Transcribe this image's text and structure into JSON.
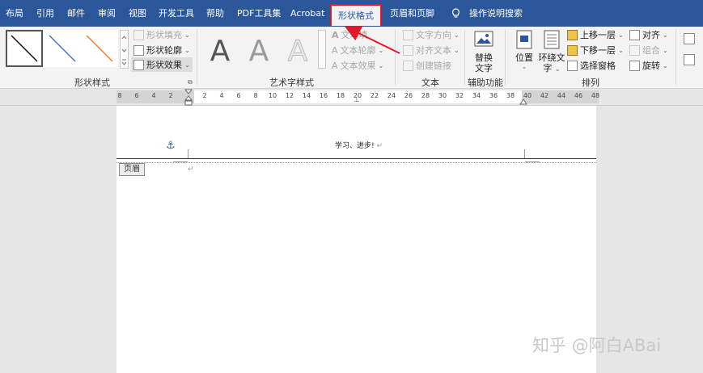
{
  "tabs": [
    {
      "label": "布局"
    },
    {
      "label": "引用"
    },
    {
      "label": "邮件"
    },
    {
      "label": "审阅"
    },
    {
      "label": "视图"
    },
    {
      "label": "开发工具"
    },
    {
      "label": "帮助"
    },
    {
      "label": "PDF工具集"
    },
    {
      "label": "Acrobat"
    },
    {
      "label": "形状格式"
    },
    {
      "label": "页眉和页脚"
    }
  ],
  "search": {
    "label": "操作说明搜索"
  },
  "ribbon": {
    "shape_styles": {
      "label": "形状样式",
      "fill": "形状填充",
      "outline": "形状轮廓",
      "effects": "形状效果"
    },
    "wordart": {
      "label": "艺术字样式",
      "glyph": "A",
      "text_fill": "文本填",
      "text_outline": "文本轮廓",
      "text_effects": "文本效果"
    },
    "text": {
      "label": "文本",
      "direction": "文字方向",
      "align": "对齐文本",
      "link": "创建链接"
    },
    "accessibility": {
      "label": "辅助功能",
      "alt_text_1": "替换",
      "alt_text_2": "文字"
    },
    "arrange": {
      "label": "排列",
      "position": "位置",
      "wrap_1": "环绕文",
      "wrap_2": "字",
      "bring_forward": "上移一层",
      "send_backward": "下移一层",
      "selection_pane": "选择窗格",
      "align": "对齐",
      "group": "组合",
      "rotate": "旋转"
    }
  },
  "ruler": {
    "left_ticks": [
      "8",
      "6",
      "4",
      "2"
    ],
    "ticks": [
      "2",
      "4",
      "6",
      "8",
      "10",
      "12",
      "14",
      "16",
      "18",
      "20",
      "22",
      "24",
      "26",
      "28",
      "30",
      "32",
      "34",
      "36",
      "38"
    ],
    "right_ticks": [
      "40",
      "42",
      "44",
      "46",
      "48"
    ]
  },
  "document": {
    "header_text": "学习、进步!",
    "header_tag": "页眉",
    "return_mark": "↵"
  },
  "watermark": "知乎 @阿白ABai",
  "colors": {
    "accent": "#2b579a",
    "highlight": "#e0192a"
  }
}
